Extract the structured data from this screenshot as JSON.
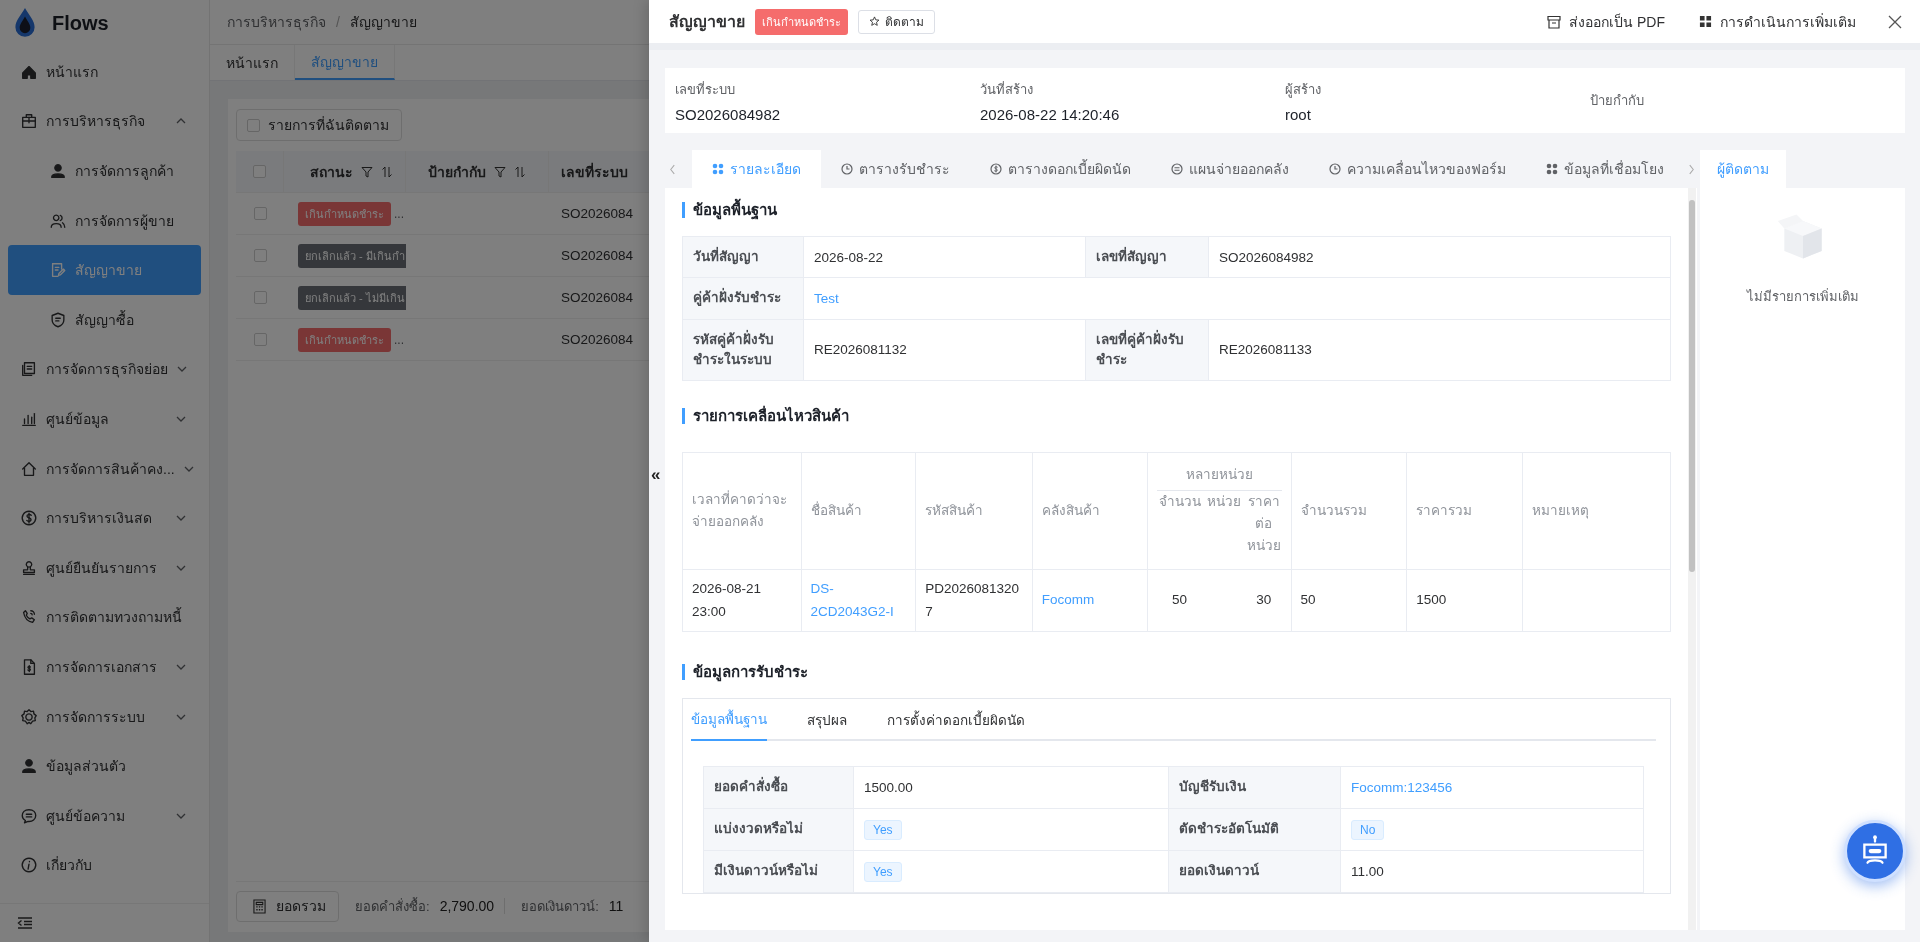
{
  "app": {
    "name": "Flows"
  },
  "sidebar": {
    "items": [
      {
        "label": "หน้าแรก",
        "selected": false
      },
      {
        "label": "การบริหารธุรกิจ",
        "selected": false,
        "expanded": true,
        "children": [
          {
            "label": "การจัดการลูกค้า",
            "selected": false
          },
          {
            "label": "การจัดการผู้ขาย",
            "selected": false
          },
          {
            "label": "สัญญาขาย",
            "selected": true
          },
          {
            "label": "สัญญาซื้อ",
            "selected": false
          }
        ]
      },
      {
        "label": "การจัดการธุรกิจย่อย",
        "selected": false,
        "expanded": false
      },
      {
        "label": "ศูนย์ข้อมูล",
        "selected": false,
        "expanded": false
      },
      {
        "label": "การจัดการสินค้าคง...",
        "selected": false,
        "expanded": false
      },
      {
        "label": "การบริหารเงินสด",
        "selected": false,
        "expanded": false
      },
      {
        "label": "ศูนย์ยืนยันรายการ",
        "selected": false,
        "expanded": false
      },
      {
        "label": "การติดตามทวงถามหนี้",
        "selected": false
      },
      {
        "label": "การจัดการเอกสาร",
        "selected": false,
        "expanded": false
      },
      {
        "label": "การจัดการระบบ",
        "selected": false,
        "expanded": false
      },
      {
        "label": "ข้อมูลส่วนตัว",
        "selected": false
      },
      {
        "label": "ศูนย์ข้อความ",
        "selected": false,
        "expanded": false
      },
      {
        "label": "เกี่ยวกับ",
        "selected": false
      }
    ]
  },
  "breadcrumb": {
    "items": [
      "การบริหารธุรกิจ",
      "สัญญาขาย"
    ],
    "separator": "/"
  },
  "page_tabs": [
    {
      "label": "หน้าแรก",
      "selected": false
    },
    {
      "label": "สัญญาขาย",
      "selected": true
    }
  ],
  "follow_filter": {
    "label": "รายการที่ฉันติดตาม",
    "checked": false
  },
  "list_table": {
    "all_checked": false,
    "columns": [
      {
        "label": "สถานะ",
        "filter": true,
        "sort": true
      },
      {
        "label": "ป้ายกำกับ",
        "filter": true,
        "sort": true
      },
      {
        "label": "เลขที่ระบบ"
      }
    ],
    "rows": [
      {
        "checked": false,
        "status": {
          "label": "เกินกำหนดชำระ",
          "kind": "overdue"
        },
        "status_more": "...",
        "system_no": "SO2026084"
      },
      {
        "checked": false,
        "status": {
          "label": "ยกเลิกแล้ว - มีเกินกำ",
          "kind": "cancelled"
        },
        "system_no": "SO2026084"
      },
      {
        "checked": false,
        "status": {
          "label": "ยกเลิกแล้ว - ไม่มีเกิน",
          "kind": "cancelled"
        },
        "system_no": "SO2026084"
      },
      {
        "checked": false,
        "status": {
          "label": "เกินกำหนดชำระ",
          "kind": "overdue"
        },
        "status_more": "...",
        "system_no": "SO2026084"
      }
    ]
  },
  "list_footer": {
    "total_button": "ยอดรวม",
    "stats": [
      {
        "label": "ยอดคำสั่งซื้อ:",
        "value": "2,790.00"
      },
      {
        "label": "ยอดเงินดาวน์:",
        "value": "11"
      }
    ]
  },
  "drawer": {
    "title": "สัญญาขาย",
    "status_tag": {
      "label": "เกินกำหนดชำระ",
      "kind": "overdue"
    },
    "follow_button": "ติดตาม",
    "actions": [
      {
        "label": "ส่งออกเป็น PDF"
      },
      {
        "label": "การดำเนินการเพิ่มเติม"
      }
    ],
    "collapse_handle": "«",
    "summary": [
      {
        "label": "เลขที่ระบบ",
        "value": "SO2026084982"
      },
      {
        "label": "วันที่สร้าง",
        "value": "2026-08-22 14:20:46"
      },
      {
        "label": "ผู้สร้าง",
        "value": "root"
      },
      {
        "label": "ป้ายกำกับ"
      }
    ],
    "tabs": [
      {
        "label": "รายละเอียด",
        "selected": true
      },
      {
        "label": "ตารางรับชำระ",
        "selected": false
      },
      {
        "label": "ตารางดอกเบี้ยผิดนัด",
        "selected": false
      },
      {
        "label": "แผนจ่ายออกคลัง",
        "selected": false
      },
      {
        "label": "ความเคลื่อนไหวของฟอร์ม",
        "selected": false
      },
      {
        "label": "ข้อมูลที่เชื่อมโยง",
        "selected": false
      }
    ],
    "basic_info": {
      "title": "ข้อมูลพื้นฐาน",
      "rows": [
        [
          {
            "label": "วันที่สัญญา",
            "value": "2026-08-22",
            "kind": "text"
          },
          {
            "label": "เลขที่สัญญา",
            "value": "SO2026084982",
            "kind": "text"
          }
        ],
        [
          {
            "label": "คู่ค้าฝั่งรับชำระ",
            "value": "Test",
            "kind": "link"
          }
        ],
        [
          {
            "label": "รหัสคู่ค้าฝั่งรับชำระในระบบ",
            "value": "RE2026081132",
            "kind": "text"
          },
          {
            "label": "เลขที่คู่ค้าฝั่งรับชำระ",
            "value": "RE2026081133",
            "kind": "text"
          }
        ]
      ]
    },
    "movements": {
      "title": "รายการเคลื่อนไหวสินค้า",
      "columns": {
        "time": "เวลาที่คาดว่าจะจ่ายออกคลัง",
        "product_name": "ชื่อสินค้า",
        "product_code": "รหัสสินค้า",
        "warehouse": "คลังสินค้า",
        "multi_unit": "หลายหน่วย",
        "quantity": "จำนวน",
        "unit": "หน่วย",
        "unit_price": "ราคาต่อหน่วย",
        "total_quantity": "จำนวนรวม",
        "total_price": "ราคารวม",
        "remark": "หมายเหตุ"
      },
      "rows": [
        {
          "time": "2026-08-21 23:00",
          "product_name": "DS-2CD2043G2-I",
          "product_code": "PD20260813207",
          "warehouse": "Focomm",
          "quantity": "50",
          "unit_price": "30",
          "total_quantity": "50",
          "total_price": "1500"
        }
      ]
    },
    "payment": {
      "title": "ข้อมูลการรับชำระ",
      "tabs": [
        {
          "label": "ข้อมูลพื้นฐาน",
          "selected": true
        },
        {
          "label": "สรุปผล",
          "selected": false
        },
        {
          "label": "การตั้งค่าดอกเบี้ยผิดนัด",
          "selected": false
        }
      ],
      "rows": [
        [
          {
            "label": "ยอดคำสั่งซื้อ",
            "value": "1500.00",
            "kind": "text"
          },
          {
            "label": "บัญชีรับเงิน",
            "value": "Focomm:123456",
            "kind": "link"
          }
        ],
        [
          {
            "label": "แบ่งงวดหรือไม่",
            "value": "Yes",
            "kind": "tag"
          },
          {
            "label": "ตัดชำระอัตโนมัติ",
            "value": "No",
            "kind": "tag"
          }
        ],
        [
          {
            "label": "มีเงินดาวน์หรือไม่",
            "value": "Yes",
            "kind": "tag"
          },
          {
            "label": "ยอดเงินดาวน์",
            "value": "11.00",
            "kind": "text"
          }
        ]
      ]
    },
    "followers": {
      "tab": {
        "label": "ผู้ติดตาม",
        "selected": true
      },
      "empty_text": "ไม่มีรายการเพิ่มเติม"
    }
  }
}
